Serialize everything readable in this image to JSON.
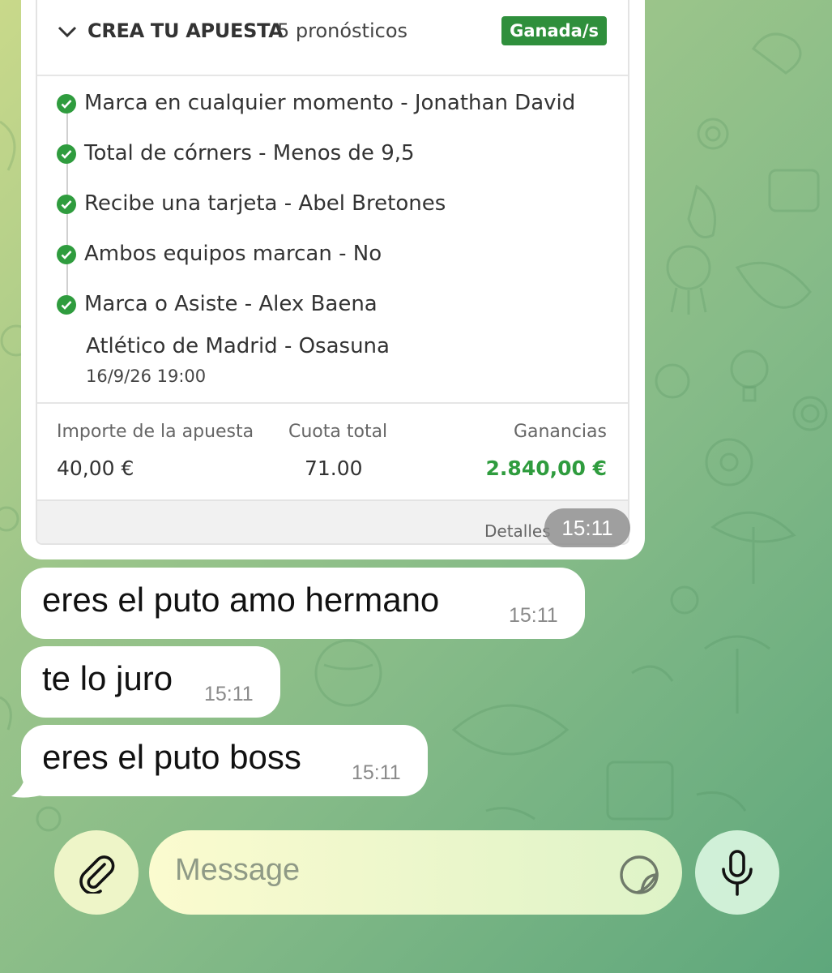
{
  "colors": {
    "accent_green": "#2f8f3c",
    "win_green": "#2f9c3e",
    "bubble_white": "#ffffff"
  },
  "bet": {
    "header_title": "CREA TU APUESTA",
    "header_count": "5 pronósticos",
    "status": "Ganada/s",
    "picks": [
      {
        "label": "Marca en cualquier momento - Jonathan David",
        "icon": "check-circle-icon"
      },
      {
        "label": "Total de córners - Menos de 9,5",
        "icon": "check-circle-icon"
      },
      {
        "label": "Recibe una tarjeta - Abel Bretones",
        "icon": "check-circle-icon"
      },
      {
        "label": "Ambos equipos marcan - No",
        "icon": "check-circle-icon"
      },
      {
        "label": "Marca o Asiste - Alex Baena",
        "icon": "check-circle-icon"
      }
    ],
    "match": "Atlético de Madrid - Osasuna",
    "match_date": "16/9/26 19:00",
    "stake_label": "Importe de la apuesta",
    "stake_value": "40,00 €",
    "odds_label": "Cuota total",
    "odds_value": "71.00",
    "winnings_label": "Ganancias",
    "winnings_value": "2.840,00 €",
    "details_link": "Detalles",
    "time": "15:11"
  },
  "messages": [
    {
      "text": "eres el puto amo hermano",
      "time": "15:11"
    },
    {
      "text": "te lo juro",
      "time": "15:11"
    },
    {
      "text": "eres el puto boss",
      "time": "15:11"
    }
  ],
  "composer": {
    "placeholder": "Message",
    "attach_icon": "paperclip-icon",
    "sticker_icon": "sticker-icon",
    "mic_icon": "microphone-icon"
  }
}
